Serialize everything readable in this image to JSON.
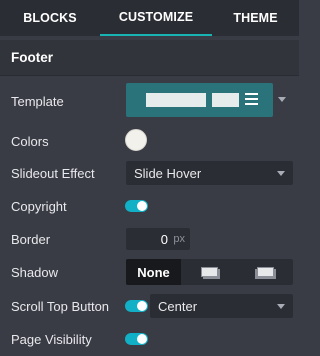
{
  "tabs": [
    {
      "label": "BLOCKS",
      "active": false
    },
    {
      "label": "CUSTOMIZE",
      "active": true
    },
    {
      "label": "THEME",
      "active": false
    }
  ],
  "section": {
    "title": "Footer"
  },
  "fields": {
    "template": {
      "label": "Template",
      "icon": "template-preview-icon"
    },
    "colors": {
      "label": "Colors",
      "value_color": "#f3f1ec"
    },
    "slideout_effect": {
      "label": "Slideout Effect",
      "value": "Slide Hover"
    },
    "copyright": {
      "label": "Copyright",
      "enabled": true
    },
    "border": {
      "label": "Border",
      "value": "0",
      "unit": "px"
    },
    "shadow": {
      "label": "Shadow",
      "options": [
        "None",
        "shadow-small-icon",
        "shadow-large-icon"
      ],
      "selected": "None"
    },
    "scroll_top_button": {
      "label": "Scroll Top Button",
      "enabled": true,
      "position": "Center"
    },
    "page_visibility": {
      "label": "Page Visibility",
      "enabled": true
    }
  },
  "colors": {
    "accent": "#18b3b3",
    "toggle_on": "#12b0c6",
    "template_bg": "#2a737b",
    "panel_bg": "#3a3c45"
  }
}
